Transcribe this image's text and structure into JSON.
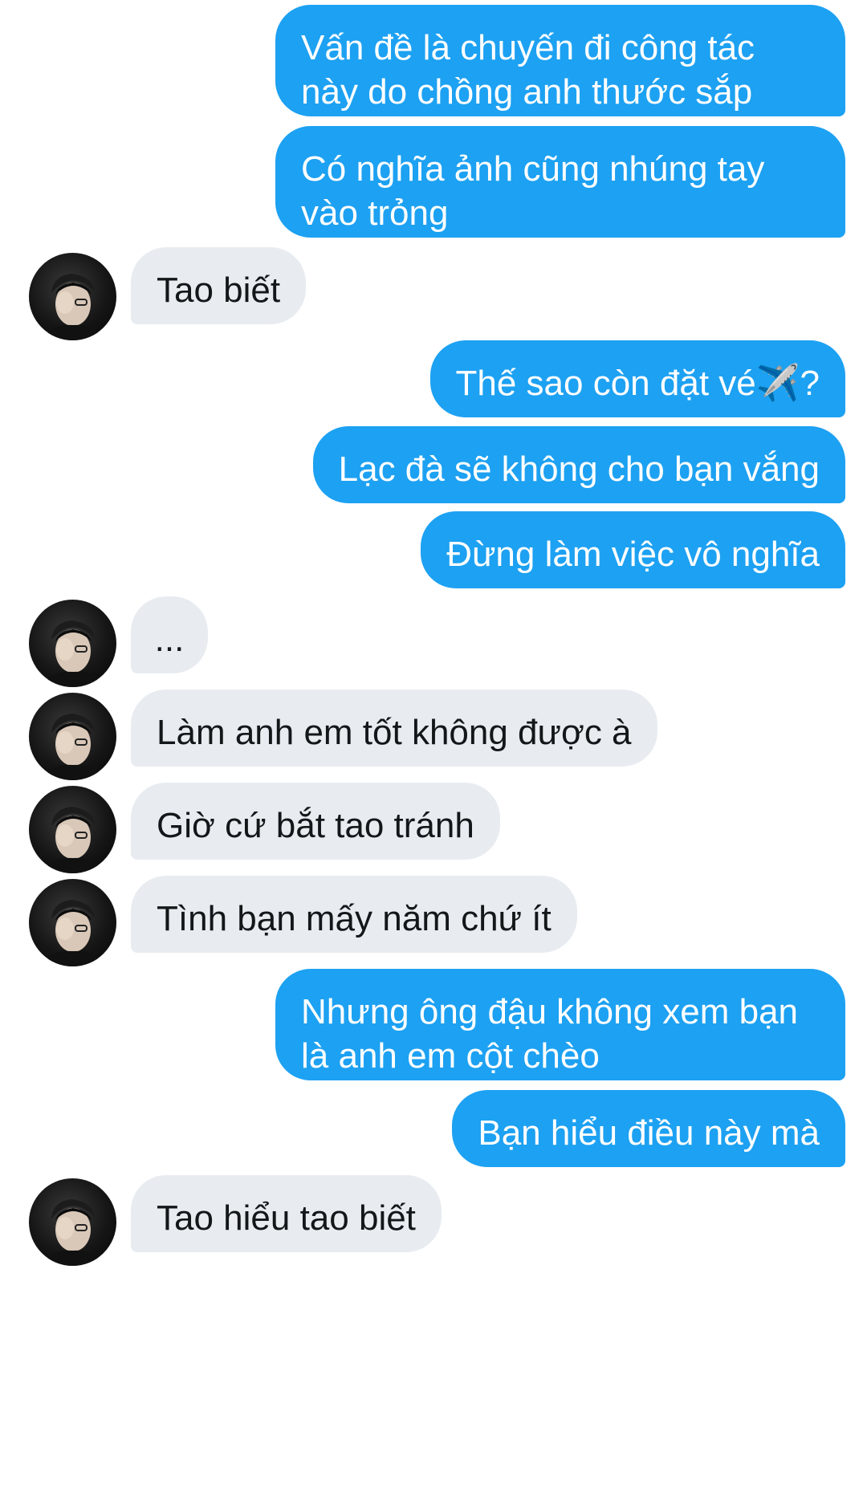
{
  "messages": [
    {
      "id": "m1",
      "side": "sent",
      "text": "Vấn đề là chuyến đi công tác\nnày do chồng anh thước sắp"
    },
    {
      "id": "m2",
      "side": "sent",
      "text": "Có nghĩa ảnh cũng nhúng tay\nvào trỏng"
    },
    {
      "id": "m3",
      "side": "received",
      "text": "Tao biết"
    },
    {
      "id": "m4",
      "side": "sent",
      "text": "Thế sao còn đặt vé✈️?"
    },
    {
      "id": "m5",
      "side": "sent",
      "text": "Lạc đà sẽ không cho bạn vắng"
    },
    {
      "id": "m6",
      "side": "sent",
      "text": "Đừng làm việc vô nghĩa"
    },
    {
      "id": "m7",
      "side": "received",
      "text": "..."
    },
    {
      "id": "m8",
      "side": "received",
      "text": "Làm anh em tốt không được à"
    },
    {
      "id": "m9",
      "side": "received",
      "text": "Giờ cứ bắt tao tránh"
    },
    {
      "id": "m10",
      "side": "received",
      "text": "Tình bạn mấy năm chứ ít"
    },
    {
      "id": "m11",
      "side": "sent",
      "text": "Nhưng ông đậu không xem bạn\nlà anh em cột chèo"
    },
    {
      "id": "m12",
      "side": "sent",
      "text": "Bạn hiểu điều này mà"
    },
    {
      "id": "m13",
      "side": "received",
      "text": "Tao hiểu tao biết"
    }
  ],
  "avatar_icon": "user-avatar-photo",
  "colors": {
    "sent_bubble": "#1da1f2",
    "sent_text": "#ffffff",
    "received_bubble": "#e8ecf0",
    "received_text": "#14171a",
    "background": "#ffffff"
  }
}
